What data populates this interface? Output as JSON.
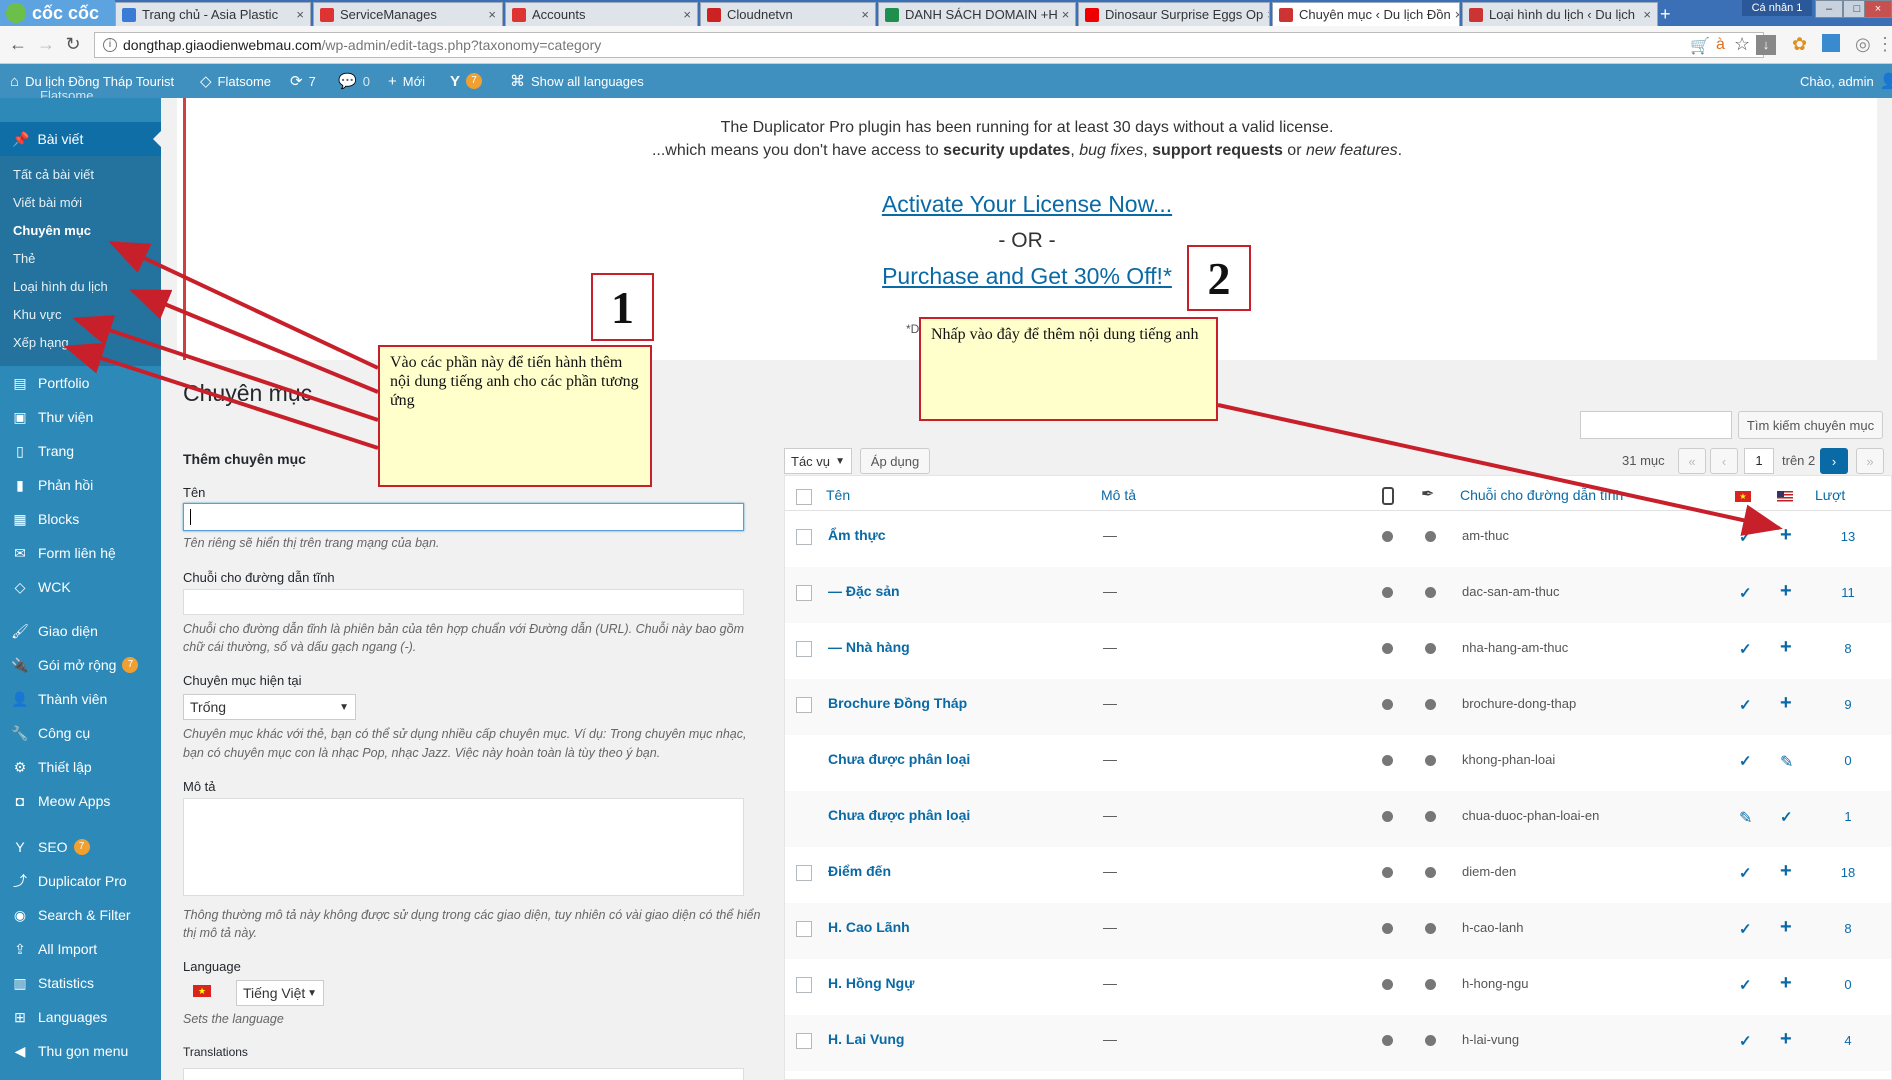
{
  "browser": {
    "logo": "cốc cốc",
    "user_chip": "Cá nhân 1",
    "tabs": [
      {
        "label": "Trang chủ - Asia Plastic",
        "color": "#3a7bd5"
      },
      {
        "label": "ServiceManages",
        "color": "#d33"
      },
      {
        "label": "Accounts",
        "color": "#d33"
      },
      {
        "label": "Cloudnetvn",
        "color": "#c22"
      },
      {
        "label": "DANH SÁCH DOMAIN +H",
        "color": "#1e8f4c"
      },
      {
        "label": "Dinosaur Surprise Eggs Op",
        "color": "#e00"
      },
      {
        "label": "Chuyên mục ‹ Du lịch Đồn",
        "color": "#c33"
      },
      {
        "label": "Loại hình du lịch ‹ Du lịch",
        "color": "#c33"
      }
    ],
    "url_host": "dongthap.giaodienwebmau.com",
    "url_path": "/wp-admin/edit-tags.php?taxonomy=category"
  },
  "adminbar": {
    "site": "Du lịch Đồng Tháp Tourist",
    "theme": "Flatsome",
    "updates": "7",
    "comments": "0",
    "new": "Mới",
    "seo_badge": "7",
    "languages": "Show all languages",
    "greeting": "Chào, admin"
  },
  "sidebar": {
    "cut_top": "Flatsome",
    "posts": "Bài viết",
    "sub": [
      "Tất cả bài viết",
      "Viết bài mới",
      "Chuyên mục",
      "Thẻ",
      "Loại hình du lịch",
      "Khu vực",
      "Xếp hạng"
    ],
    "menu": [
      "Portfolio",
      "Thư viện",
      "Trang",
      "Phản hồi",
      "Blocks",
      "Form liên hệ",
      "WCK",
      "Giao diện",
      "Gói mở rộng",
      "Thành viên",
      "Công cụ",
      "Thiết lập",
      "Meow Apps",
      "SEO",
      "Duplicator Pro",
      "Search & Filter",
      "All Import",
      "Statistics",
      "Languages",
      "Thu gọn menu"
    ],
    "plugins_badge": "7",
    "seo_badge": "7"
  },
  "notice": {
    "line1": "The Duplicator Pro plugin has been running for at least 30 days without a valid license.",
    "line2_a": "...which means you don't have access to ",
    "line2_b": "security updates",
    "line2_c": ", ",
    "line2_d": "bug fixes",
    "line2_e": ", ",
    "line2_f": "support requests",
    "line2_g": " or ",
    "line2_h": "new features",
    "line2_i": ".",
    "activate": "Activate Your License Now...",
    "or": "- OR -",
    "purchase": "Purchase and Get 30% Off!*",
    "footnote": "*D"
  },
  "page": {
    "title": "Chuyên mục"
  },
  "form": {
    "heading": "Thêm chuyên mục",
    "name_label": "Tên",
    "name_help": "Tên riêng sẽ hiển thị trên trang mạng của bạn.",
    "slug_label": "Chuỗi cho đường dẫn tĩnh",
    "slug_help1": "Chuỗi cho đường dẫn tĩnh là phiên bản của tên hợp chuẩn với Đường dẫn (URL). Chuỗi này bao gồm",
    "slug_help2": "chữ cái thường, số và dấu gạch ngang (-).",
    "parent_label": "Chuyên mục hiện tại",
    "parent_value": "Trống",
    "parent_help1": "Chuyên mục khác với thẻ, bạn có thể sử dụng nhiều cấp chuyên mục. Ví dụ: Trong chuyên mục nhạc,",
    "parent_help2": "bạn có chuyên mục con là nhạc Pop, nhạc Jazz. Việc này hoàn toàn là tùy theo ý bạn.",
    "desc_label": "Mô tả",
    "desc_help1": "Thông thường mô tả này không được sử dụng trong các giao diện, tuy nhiên có vài giao diện có thể hiển",
    "desc_help2": "thị mô tả này.",
    "lang_label": "Language",
    "lang_value": "Tiếng Việt",
    "lang_help": "Sets the language",
    "translations_label": "Translations"
  },
  "list": {
    "search_button": "Tìm kiếm chuyên mục",
    "bulk_value": "Tác vụ",
    "apply": "Áp dụng",
    "count": "31 mục",
    "page_current": "1",
    "page_of": "trên 2",
    "nav_first": "«",
    "nav_prev": "‹",
    "nav_next": "›",
    "nav_last": "»",
    "columns": {
      "name": "Tên",
      "desc": "Mô tả",
      "slug": "Chuỗi cho đường dẫn tĩnh",
      "count": "Lượt"
    },
    "rows": [
      {
        "name": "Ẩm thực",
        "desc": "—",
        "slug": "am-thuc",
        "vi": "✓",
        "en": "+",
        "count": "13",
        "cb": true
      },
      {
        "name": "— Đặc sản",
        "desc": "—",
        "slug": "dac-san-am-thuc",
        "vi": "✓",
        "en": "+",
        "count": "11",
        "cb": true
      },
      {
        "name": "— Nhà hàng",
        "desc": "—",
        "slug": "nha-hang-am-thuc",
        "vi": "✓",
        "en": "+",
        "count": "8",
        "cb": true
      },
      {
        "name": "Brochure Đồng Tháp",
        "desc": "—",
        "slug": "brochure-dong-thap",
        "vi": "✓",
        "en": "+",
        "count": "9",
        "cb": true
      },
      {
        "name": "Chưa được phân loại",
        "desc": "—",
        "slug": "khong-phan-loai",
        "vi": "✓",
        "en": "✎",
        "count": "0",
        "cb": false
      },
      {
        "name": "Chưa được phân loại",
        "desc": "—",
        "slug": "chua-duoc-phan-loai-en",
        "vi": "✎",
        "en": "✓",
        "count": "1",
        "cb": false
      },
      {
        "name": "Điểm đến",
        "desc": "—",
        "slug": "diem-den",
        "vi": "✓",
        "en": "+",
        "count": "18",
        "cb": true
      },
      {
        "name": "H. Cao Lãnh",
        "desc": "—",
        "slug": "h-cao-lanh",
        "vi": "✓",
        "en": "+",
        "count": "8",
        "cb": true
      },
      {
        "name": "H. Hồng Ngự",
        "desc": "—",
        "slug": "h-hong-ngu",
        "vi": "✓",
        "en": "+",
        "count": "0",
        "cb": true
      },
      {
        "name": "H. Lai Vung",
        "desc": "—",
        "slug": "h-lai-vung",
        "vi": "✓",
        "en": "+",
        "count": "4",
        "cb": true
      }
    ]
  },
  "annotations": {
    "num1": "1",
    "num2": "2",
    "note1": "Vào các phần này để tiến hành thêm nội dung tiếng anh cho các phần tương ứng",
    "note2": "Nhấp vào đây để thêm nội dung tiếng anh",
    "color": "#c8202a"
  }
}
